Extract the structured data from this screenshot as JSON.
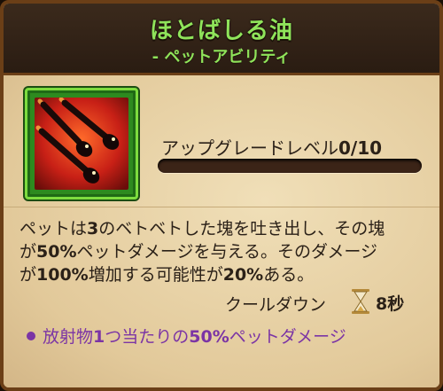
{
  "header": {
    "title": "ほとばしる油",
    "subtitle": "- ペットアビリティ"
  },
  "ability": {
    "icon": "flaming-oil-blob-icon",
    "upgrade_label": "アップグレードレベル",
    "upgrade_value": "0/10",
    "upgrade_progress": 0
  },
  "description": {
    "line1_a": "ペットは",
    "line1_b": "3",
    "line1_c": "のベトベトした塊を吐き出し、その塊",
    "line2_a": "が",
    "line2_b": "50%",
    "line2_c": "ペットダメージを与える。そのダメージ",
    "line3_a": "が",
    "line3_b": "100%",
    "line3_c": "増加する可能性が",
    "line3_d": "20%",
    "line3_e": "ある。"
  },
  "cooldown": {
    "label": "クールダウン",
    "icon": "hourglass-icon",
    "value": "8秒"
  },
  "bonus": {
    "text_a": "放射物",
    "text_b": "1",
    "text_c": "つ当たりの",
    "text_d": "50%",
    "text_e": "ペットダメージ"
  },
  "colors": {
    "title_green": "#8fe35a",
    "bonus_purple": "#7b34a5",
    "icon_frame_green": "#7ddc3e"
  }
}
